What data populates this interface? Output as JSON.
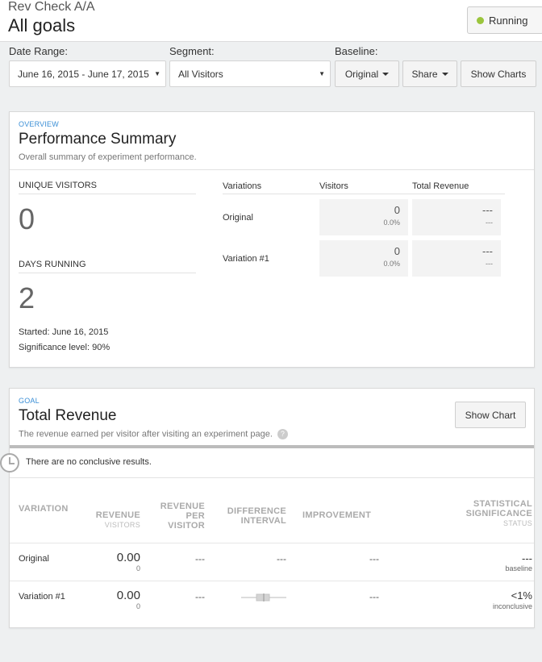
{
  "header": {
    "experiment_name": "Rev Check A/A",
    "goal_title": "All goals",
    "status_label": "Running",
    "status_color": "#9bc53d"
  },
  "filters": {
    "date_range_label": "Date Range:",
    "date_range_value": "June 16, 2015 - June 17, 2015",
    "segment_label": "Segment:",
    "segment_value": "All Visitors",
    "baseline_label": "Baseline:",
    "baseline_value": "Original",
    "share_label": "Share",
    "show_charts_label": "Show Charts"
  },
  "overview": {
    "eyebrow": "OVERVIEW",
    "title": "Performance Summary",
    "description": "Overall summary of experiment performance.",
    "unique_visitors_label": "UNIQUE VISITORS",
    "unique_visitors_value": "0",
    "days_running_label": "DAYS RUNNING",
    "days_running_value": "2",
    "started": "Started: June 16, 2015",
    "significance": "Significance level: 90%",
    "columns": [
      "Variations",
      "Visitors",
      "Total Revenue"
    ],
    "rows": [
      {
        "name": "Original",
        "visitors": "0",
        "visitors_pct": "0.0%",
        "revenue": "---",
        "revenue_sub": "---"
      },
      {
        "name": "Variation #1",
        "visitors": "0",
        "visitors_pct": "0.0%",
        "revenue": "---",
        "revenue_sub": "---"
      }
    ]
  },
  "goal": {
    "eyebrow": "GOAL",
    "title": "Total Revenue",
    "description": "The revenue earned per visitor after visiting an experiment page.",
    "help_glyph": "?",
    "show_chart_label": "Show Chart",
    "result_text": "There are no conclusive results.",
    "columns": {
      "variation": "VARIATION",
      "revenue": "REVENUE",
      "revenue_sub": "VISITORS",
      "rpv_1": "REVENUE",
      "rpv_2": "PER",
      "rpv_3": "VISITOR",
      "diff_1": "DIFFERENCE",
      "diff_2": "INTERVAL",
      "improvement": "IMPROVEMENT",
      "sig_1": "STATISTICAL",
      "sig_2": "SIGNIFICANCE",
      "sig_sub": "STATUS"
    },
    "rows": [
      {
        "name": "Original",
        "revenue": "0.00",
        "visitors": "0",
        "rpv": "---",
        "interval": "---",
        "improvement": "---",
        "significance": "---",
        "status": "baseline"
      },
      {
        "name": "Variation #1",
        "revenue": "0.00",
        "visitors": "0",
        "rpv": "---",
        "interval": "",
        "improvement": "---",
        "significance": "<1%",
        "status": "inconclusive"
      }
    ]
  }
}
